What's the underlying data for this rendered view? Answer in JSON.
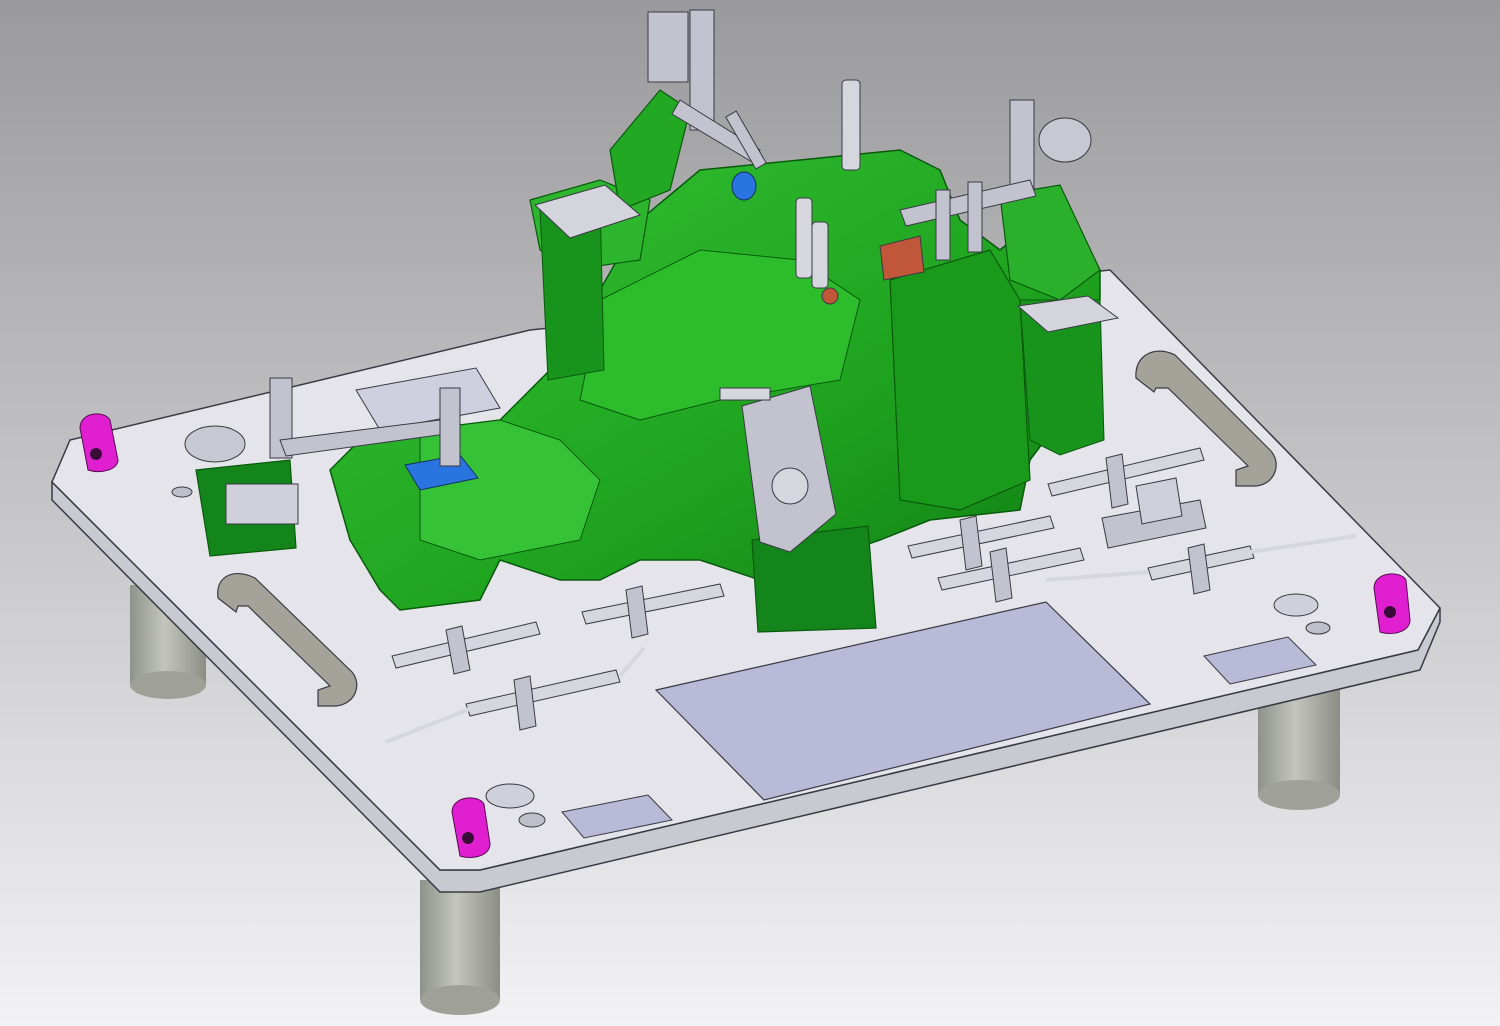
{
  "scene": {
    "colors": {
      "background_top": "#9a9a9c",
      "background_bottom": "#f2f2f4",
      "plate_top": "#e4e4ea",
      "plate_edge": "#c9c9d2",
      "plate_outline": "#3a3a44",
      "fixture_green": "#1fa31f",
      "fixture_green_light": "#35c435",
      "fixture_green_dark": "#0f7a12",
      "legs": "#b0b2aa",
      "handles": "#a3a39a",
      "clamps": "#c3c3d0",
      "inspection_plate": "#b9b9d8",
      "locators_magenta": "#e020d0",
      "pins": "#d6d6de",
      "blue_block": "#2a74e0",
      "copper_accent": "#c0563a"
    },
    "icons": [
      "steel-base-plate",
      "green-checking-fixture-body",
      "toggle-clamp-icon",
      "carry-handle-icon",
      "support-leg-icon",
      "magenta-locator-icon",
      "detachable-check-pin-icon",
      "inspection-cover-plate-icon"
    ]
  }
}
